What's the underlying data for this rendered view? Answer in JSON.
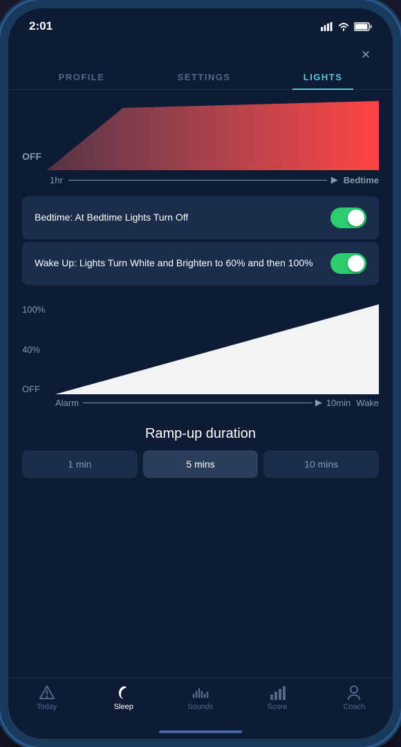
{
  "statusBar": {
    "time": "2:01",
    "signal": "●●●",
    "wifi": "wifi",
    "battery": "battery"
  },
  "closeButton": "×",
  "tabs": [
    {
      "label": "PROFILE",
      "active": false
    },
    {
      "label": "SETTINGS",
      "active": false
    },
    {
      "label": "LIGHTS",
      "active": true
    }
  ],
  "lightViz": {
    "offLabel": "OFF",
    "startLabel": "1hr",
    "endLabel": "Bedtime"
  },
  "toggles": [
    {
      "text": "Bedtime: At Bedtime Lights Turn Off",
      "enabled": true
    },
    {
      "text": "Wake Up: Lights Turn White and Brighten to 60% and then 100%",
      "enabled": true
    }
  ],
  "chart": {
    "yLabels": [
      "100%",
      "40%",
      "OFF"
    ],
    "xLabels": [
      "Alarm",
      "10min",
      "Wake"
    ]
  },
  "rampUp": {
    "title": "Ramp-up duration",
    "options": [
      "1 min",
      "5 mins",
      "10 mins"
    ],
    "activeIndex": 1
  },
  "bottomNav": [
    {
      "label": "Today",
      "icon": "today",
      "active": false
    },
    {
      "label": "Sleep",
      "icon": "sleep",
      "active": true
    },
    {
      "label": "Sounds",
      "icon": "sounds",
      "active": false
    },
    {
      "label": "Score",
      "icon": "score",
      "active": false
    },
    {
      "label": "Coach",
      "icon": "coach",
      "active": false
    }
  ]
}
